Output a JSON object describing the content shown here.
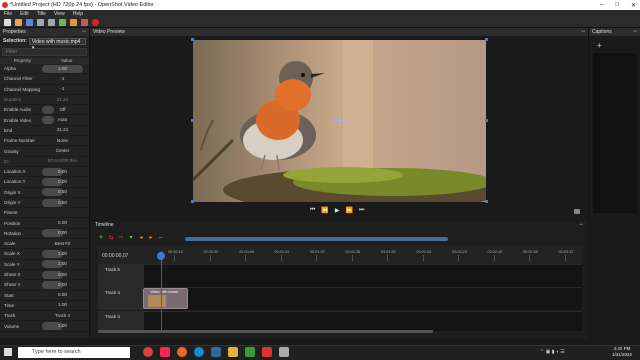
{
  "window": {
    "title": "*Untitled Project (HD 720p 24 fps) - OpenShot Video Editor",
    "controls": [
      "–",
      "□",
      "✕"
    ]
  },
  "menu": [
    "File",
    "Edit",
    "Title",
    "View",
    "Help"
  ],
  "properties": {
    "header": "Properties",
    "selection_label": "Selection:",
    "selection_value": "Video with music.mp4",
    "filter_placeholder": "Filter",
    "col_property": "Property",
    "col_value": "Value",
    "rows": [
      {
        "name": "Alpha",
        "value": "1.00",
        "fill": 1
      },
      {
        "name": "Channel Filter",
        "value": "-1",
        "fill": 0
      },
      {
        "name": "Channel Mapping",
        "value": "-1",
        "fill": 0
      },
      {
        "name": "Duration",
        "value": "21.21",
        "fill": 0
      },
      {
        "name": "Enable Audio",
        "value": "Off",
        "fill": 0.3
      },
      {
        "name": "Enable Video",
        "value": "Auto",
        "fill": 0.3
      },
      {
        "name": "End",
        "value": "21.21",
        "fill": 0
      },
      {
        "name": "Frame Number",
        "value": "None",
        "fill": 0
      },
      {
        "name": "Gravity",
        "value": "Center",
        "fill": 0
      },
      {
        "name": "ID",
        "value": "5TVU4OPJNA",
        "fill": 0
      },
      {
        "name": "Location X",
        "value": "0.00",
        "fill": 0.5
      },
      {
        "name": "Location Y",
        "value": "0.00",
        "fill": 0.5
      },
      {
        "name": "Origin X",
        "value": "0.50",
        "fill": 0.5
      },
      {
        "name": "Origin Y",
        "value": "0.50",
        "fill": 0.5
      },
      {
        "name": "Parent",
        "value": "",
        "fill": 0
      },
      {
        "name": "Position",
        "value": "0.00",
        "fill": 0
      },
      {
        "name": "Rotation",
        "value": "0.00",
        "fill": 0.5
      },
      {
        "name": "Scale",
        "value": "Best Fit",
        "fill": 0
      },
      {
        "name": "Scale X",
        "value": "1.00",
        "fill": 0.5
      },
      {
        "name": "Scale Y",
        "value": "1.00",
        "fill": 0.5
      },
      {
        "name": "Shear X",
        "value": "0.00",
        "fill": 0.5
      },
      {
        "name": "Shear Y",
        "value": "0.00",
        "fill": 0.5
      },
      {
        "name": "Start",
        "value": "0.00",
        "fill": 0
      },
      {
        "name": "Time",
        "value": "1.00",
        "fill": 0
      },
      {
        "name": "Track",
        "value": "Track 4",
        "fill": 0
      },
      {
        "name": "Volume",
        "value": "1.00",
        "fill": 0.5
      }
    ]
  },
  "preview": {
    "header": "Video Preview"
  },
  "captions": {
    "header": "Captions"
  },
  "timeline": {
    "header": "Timeline",
    "timecode": "00:00:00,07",
    "ticks": [
      "00:00:16",
      "00:00:32",
      "00:00:48",
      "00:01:04",
      "00:01:20",
      "00:01:36",
      "00:01:52",
      "00:02:08",
      "00:02:24",
      "00:02:40",
      "00:02:56",
      "00:03:12"
    ],
    "tracks": [
      {
        "label": "Track 5"
      },
      {
        "label": "Track 4"
      },
      {
        "label": "Track 3"
      }
    ],
    "clip_title": "Video with music"
  },
  "taskbar": {
    "search_placeholder": "Type here to search",
    "time": "4:42 PM",
    "date": "1/31/2022"
  },
  "colors": {
    "accent": "#3a7ad8",
    "playhead": "#d23",
    "clip": "#7a6a72"
  }
}
